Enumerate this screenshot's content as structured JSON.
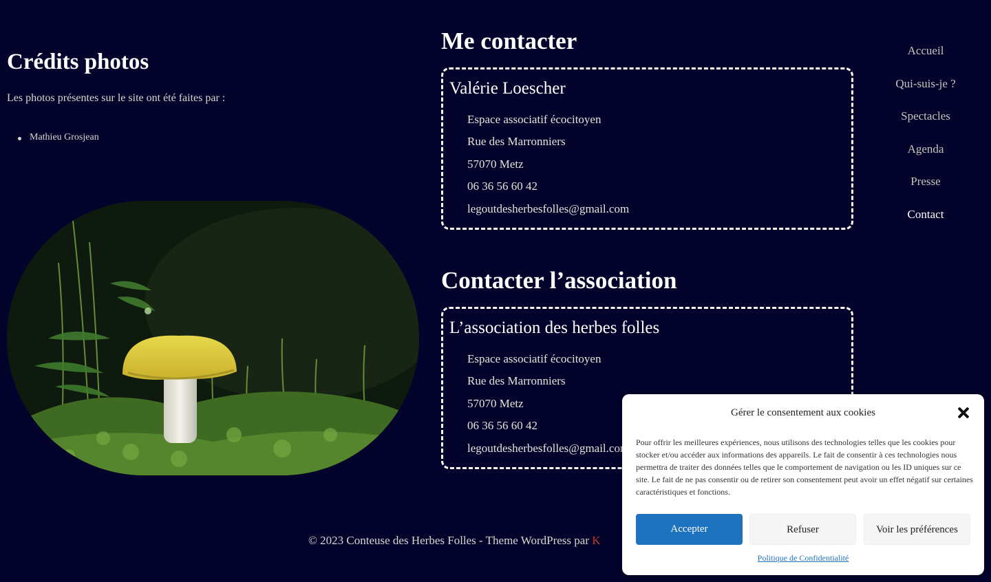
{
  "credits": {
    "title": "Crédits photos",
    "text": "Les photos présentes sur le site ont été faites par :",
    "photographers": [
      "Mathieu Grosjean"
    ]
  },
  "contact_me": {
    "title": "Me contacter",
    "name": "Valérie Loescher",
    "lines": [
      "Espace associatif écocitoyen",
      "Rue des Marronniers",
      "57070 Metz",
      "06 36 56 60 42",
      "legoutdesherbesfolles@gmail.com"
    ]
  },
  "contact_assoc": {
    "title": "Contacter l’association",
    "name": "L’association des herbes folles",
    "lines": [
      "Espace associatif écocitoyen",
      "Rue des Marronniers",
      "57070 Metz",
      "06 36 56 60 42",
      "legoutdesherbesfolles@gmail.com"
    ]
  },
  "nav": {
    "items": [
      "Accueil",
      "Qui-suis-je ?",
      "Spectacles",
      "Agenda",
      "Presse",
      "Contact"
    ],
    "active": "Contact"
  },
  "footer": {
    "text": "© 2023 Conteuse des Herbes Folles - Theme WordPress par ",
    "link": "K"
  },
  "cookie": {
    "title": "Gérer le consentement aux cookies",
    "text": "Pour offrir les meilleures expériences, nous utilisons des technologies telles que les cookies pour stocker et/ou accéder aux informations des appareils. Le fait de consentir à ces technologies nous permettra de traiter des données telles que le comportement de navigation ou les ID uniques sur ce site. Le fait de ne pas consentir ou de retirer son consentement peut avoir un effet négatif sur certaines caractéristiques et fonctions.",
    "accept": "Accepter",
    "refuse": "Refuser",
    "preferences": "Voir les préférences",
    "policy": "Politique de Confidentialité"
  },
  "colors": {
    "background": "#03032c",
    "accept_button": "#1e73be",
    "link": "#c0392b"
  }
}
